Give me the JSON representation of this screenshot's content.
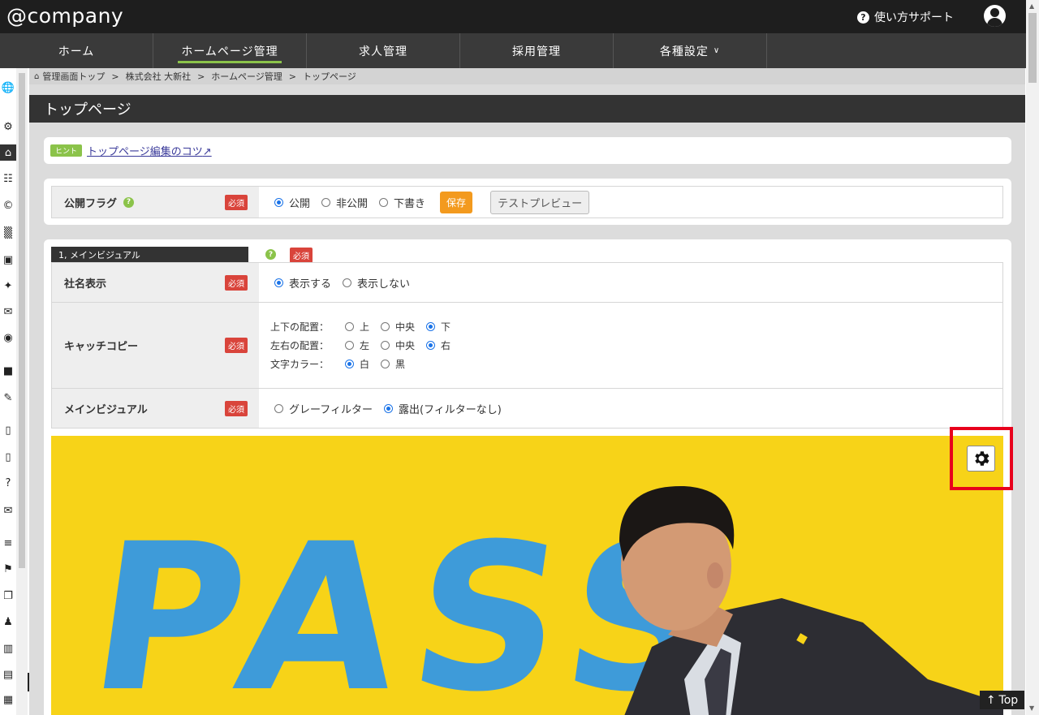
{
  "header": {
    "logo": "@company",
    "help_label": "使い方サポート"
  },
  "nav": {
    "items": [
      {
        "label": "ホーム"
      },
      {
        "label": "ホームページ管理"
      },
      {
        "label": "求人管理"
      },
      {
        "label": "採用管理"
      },
      {
        "label": "各種設定"
      }
    ],
    "active_index": 1,
    "accent_color": "#8bc34a"
  },
  "breadcrumb": [
    "管理画面トップ",
    "株式会社 大新社",
    "ホームページ管理",
    "トップページ"
  ],
  "page_title": "トップページ",
  "hint": {
    "badge": "ヒント",
    "link": "トップページ編集のコツ"
  },
  "publish": {
    "label": "公開フラグ",
    "required": "必須",
    "options": [
      "公開",
      "非公開",
      "下書き"
    ],
    "selected": "公開",
    "save_label": "保存",
    "preview_label": "テストプレビュー"
  },
  "main_visual_section": {
    "title": "1, メインビジュアル",
    "required": "必須",
    "company_name": {
      "label": "社名表示",
      "required": "必須",
      "options": [
        "表示する",
        "表示しない"
      ],
      "selected": "表示する"
    },
    "catch_copy": {
      "label": "キャッチコピー",
      "required": "必須",
      "vertical": {
        "label": "上下の配置：",
        "options": [
          "上",
          "中央",
          "下"
        ],
        "selected": "下"
      },
      "horizontal": {
        "label": "左右の配置：",
        "options": [
          "左",
          "中央",
          "右"
        ],
        "selected": "右"
      },
      "color": {
        "label": "文字カラー：",
        "options": [
          "白",
          "黒"
        ],
        "selected": "白"
      }
    },
    "main_visual": {
      "label": "メインビジュアル",
      "required": "必須",
      "options": [
        "グレーフィルター",
        "露出(フィルターなし)"
      ],
      "selected": "露出(フィルターなし)"
    },
    "image_text": "PASS"
  },
  "scroll_top_label": "Top",
  "colors": {
    "required_badge": "#d9443b",
    "save_button": "#f39a1e",
    "visual_background": "#f7d318",
    "highlight_border": "#e8001c"
  }
}
